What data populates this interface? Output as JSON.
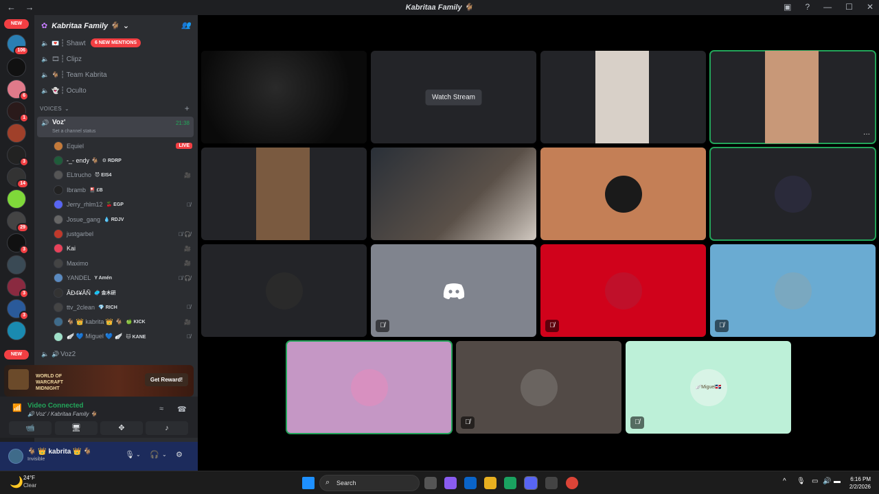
{
  "window": {
    "title": "Kabritaa Family 🐐",
    "back": "←",
    "forward": "→",
    "help": "?",
    "minimize": "—",
    "maximize": "☐",
    "close": "✕"
  },
  "servers": {
    "new_top": "NEW",
    "new_bottom": "NEW",
    "badges": [
      "106",
      "6",
      "1",
      "3",
      "14",
      "29",
      "3",
      "3",
      "3"
    ]
  },
  "guild": {
    "name": "Kabritaa Family 🐐",
    "chevron": "⌄"
  },
  "channels": [
    {
      "emoji": "💌",
      "name": "┆ Shawt"
    },
    {
      "emoji": "🎞",
      "name": "┆ Clipz"
    },
    {
      "emoji": "🐐",
      "name": "┆ Team Kabrita"
    },
    {
      "emoji": "👻",
      "name": "┆ Oculto"
    }
  ],
  "mentions_pill": "6 NEW MENTIONS",
  "voices_section": "VOICES",
  "active_voice": {
    "name": "Voz'",
    "status": "Set a channel status",
    "time": "21:38"
  },
  "members": [
    {
      "name": "Equiel",
      "tag": "",
      "right": "LIVE",
      "color": "#c47a3a"
    },
    {
      "name": "-_- endy 🐐",
      "tag": "⚙ RDRP",
      "right": "",
      "color": "#1f5c3a"
    },
    {
      "name": "ELtrucho",
      "tag": "😈 EIS4",
      "right": "🎥",
      "color": "#555"
    },
    {
      "name": "Ibramb",
      "tag": "🎴 £B",
      "right": "",
      "color": "#222"
    },
    {
      "name": "Jerry_rhlm12",
      "tag": "🍒 EGP",
      "right": "🎙̸",
      "color": "#5865f2"
    },
    {
      "name": "Josue_gang",
      "tag": "💧 RDJV",
      "right": "",
      "color": "#666"
    },
    {
      "name": "justgarbel",
      "tag": "",
      "right": "🎙̸ 🎧̸",
      "color": "#c0392b"
    },
    {
      "name": "Kai",
      "tag": "",
      "right": "🎥",
      "color": "#e8425a"
    },
    {
      "name": "Maximo",
      "tag": "",
      "right": "🎥",
      "color": "#444"
    },
    {
      "name": "YANDEL",
      "tag": "Y Amén",
      "right": "🎙̸ 🎧̸",
      "color": "#5a8ac0"
    },
    {
      "name": "ÂĐ4¥ĂÑ",
      "tag": "🥏 金木研",
      "right": "",
      "color": "#333"
    },
    {
      "name": "ttv_2clean",
      "tag": "💎 RICH",
      "right": "🎙̸",
      "color": "#444"
    },
    {
      "name": "🐐 👑 kabrita 👑 🐐",
      "tag": "🍏 KICK",
      "right": "🎥",
      "color": "#3f6b8a"
    },
    {
      "name": "🪽 💙 Miguel 💙 🪽",
      "tag": "🐱 KANE",
      "right": "🎙̸",
      "color": "#9fe0c8"
    }
  ],
  "voz2": "Voz2",
  "promo": {
    "game": "WORLD OF WARCRAFT MIDNIGHT",
    "cta": "Get Reward!"
  },
  "voice_status": {
    "connected": "Video Connected",
    "channel": "🔊 Voz' / Kabritaa Family 🐐"
  },
  "user": {
    "name": "🐐 👑 kabrita 👑 🐐",
    "status": "Invisible"
  },
  "tiles": [
    {
      "kind": "video",
      "bg": "#151515"
    },
    {
      "kind": "stream",
      "label": "Watch Stream",
      "bg": "#232428"
    },
    {
      "kind": "video",
      "bg": "#232428"
    },
    {
      "kind": "video",
      "bg": "#232428",
      "speaking": true,
      "more": "···"
    },
    {
      "kind": "video",
      "bg": "#232428"
    },
    {
      "kind": "video",
      "bg": "#3a3a3a"
    },
    {
      "kind": "avatar",
      "bg": "#c47f56",
      "avatar_color": "#1a1a1a"
    },
    {
      "kind": "avatar",
      "bg": "#232428",
      "speaking": true,
      "avatar_color": "#2a2a3a"
    },
    {
      "kind": "avatar",
      "bg": "#232428",
      "avatar_color": "#2a2a2a"
    },
    {
      "kind": "discord",
      "bg": "#80848e",
      "muted": true
    },
    {
      "kind": "avatar",
      "bg": "#d0021b",
      "avatar_color": "#c0102a",
      "muted": true
    },
    {
      "kind": "avatar",
      "bg": "#6aabd2",
      "avatar_color": "#7aa8c0",
      "muted": true
    },
    {
      "kind": "avatar",
      "bg": "#c597c5",
      "speaking": true,
      "avatar_color": "#d890c0"
    },
    {
      "kind": "avatar",
      "bg": "#524a46",
      "avatar_color": "#6a6460",
      "muted": true
    },
    {
      "kind": "avatar",
      "bg": "#bdf0d8",
      "avatar_color": "#d8f4e6",
      "avatar_text": "🪽Miguel🇩🇴",
      "muted": true
    }
  ],
  "taskbar": {
    "temp": "24°F",
    "condition": "Clear",
    "search": "Search",
    "time": "6:16 PM",
    "date": "2/2/2026"
  }
}
